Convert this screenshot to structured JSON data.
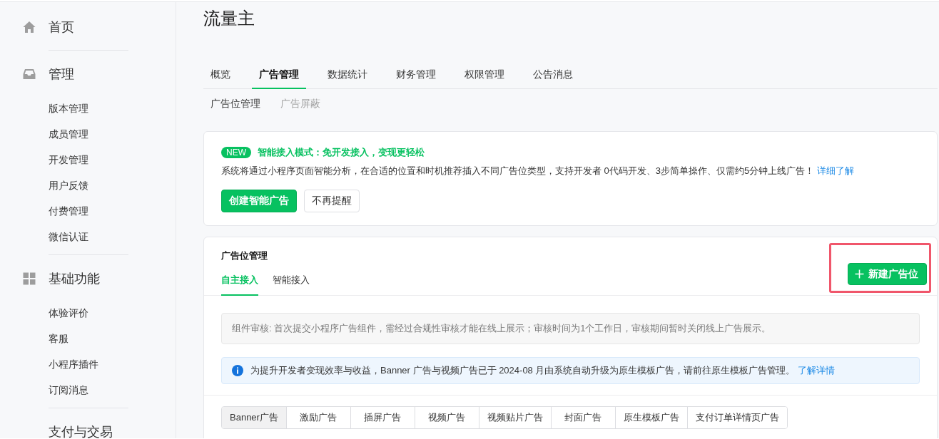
{
  "sidebar": {
    "groups": [
      {
        "label": "首页"
      },
      {
        "label": "管理",
        "items": [
          "版本管理",
          "成员管理",
          "开发管理",
          "用户反馈",
          "付费管理",
          "微信认证"
        ]
      },
      {
        "label": "基础功能",
        "items": [
          "体验评价",
          "客服",
          "小程序插件",
          "订阅消息"
        ]
      },
      {
        "label": "支付与交易"
      }
    ]
  },
  "page_title": "流量主",
  "tabs": [
    {
      "label": "概览",
      "selected": false
    },
    {
      "label": "广告管理",
      "selected": true
    },
    {
      "label": "数据统计",
      "selected": false
    },
    {
      "label": "财务管理",
      "selected": false
    },
    {
      "label": "权限管理",
      "selected": false
    },
    {
      "label": "公告消息",
      "selected": false
    }
  ],
  "subtabs": [
    {
      "label": "广告位管理",
      "selected": true
    },
    {
      "label": "广告屏蔽",
      "selected": false
    }
  ],
  "promo_card": {
    "badge": "NEW",
    "title": "智能接入模式：免开发接入，变现更轻松",
    "description": "系统将通过小程序页面智能分析，在合适的位置和时机推荐插入不同广告位类型，支持开发者 0代码开发、3步简单操作、仅需约5分钟上线广告！",
    "link": "详细了解",
    "buttons": [
      {
        "label": "创建智能广告",
        "kind": "primary"
      },
      {
        "label": "不再提醒",
        "kind": "default"
      }
    ]
  },
  "slot_card": {
    "title": "广告位管理",
    "tabs": [
      {
        "label": "自主接入",
        "selected": true
      },
      {
        "label": "智能接入",
        "selected": false
      }
    ],
    "new_button": {
      "label": "新建广告位",
      "highlighted": true
    },
    "notice": "组件审核: 首次提交小程序广告组件，需经过合规性审核才能在线上展示；审核时间为1个工作日，审核期间暂时关闭线上广告展示。",
    "info": {
      "text": "为提升开发者变现效率与收益，Banner 广告与视频广告已于 2024-08 月由系统自动升级为原生模板广告，请前往原生模板广告管理。",
      "link": "了解详情"
    },
    "ad_types": [
      {
        "label": "Banner广告",
        "selected": true
      },
      {
        "label": "激励广告",
        "selected": false
      },
      {
        "label": "插屏广告",
        "selected": false
      },
      {
        "label": "视频广告",
        "selected": false
      },
      {
        "label": "视频贴片广告",
        "selected": false
      },
      {
        "label": "封面广告",
        "selected": false
      },
      {
        "label": "原生模板广告",
        "selected": false
      },
      {
        "label": "支付订单详情页广告",
        "selected": false
      }
    ]
  }
}
